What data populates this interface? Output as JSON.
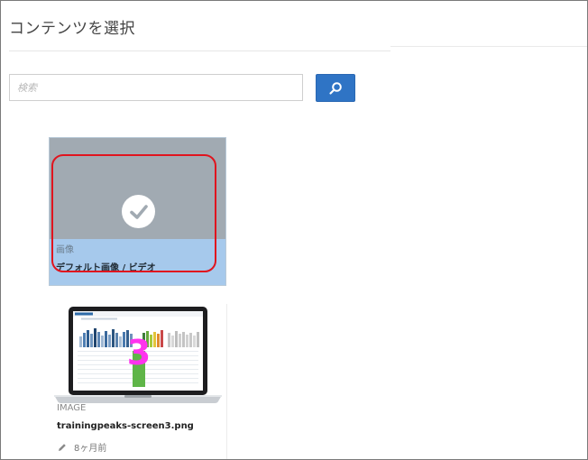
{
  "header": {
    "title": "コンテンツを選択"
  },
  "search": {
    "placeholder": "検索",
    "button_icon": "search-icon"
  },
  "colors": {
    "accent": "#2f74c5",
    "selected_bg": "#a6c9ec",
    "highlight_outline": "#e0141e"
  },
  "cards": [
    {
      "type": "画像",
      "name": "デフォルト画像 / ビデオ",
      "selected": true,
      "icon": "check-icon"
    },
    {
      "type": "IMAGE",
      "name": "trainingpeaks-screen3.png",
      "edited": "8ヶ月前",
      "overlay_number": "3",
      "icon": "pencil-icon"
    }
  ]
}
